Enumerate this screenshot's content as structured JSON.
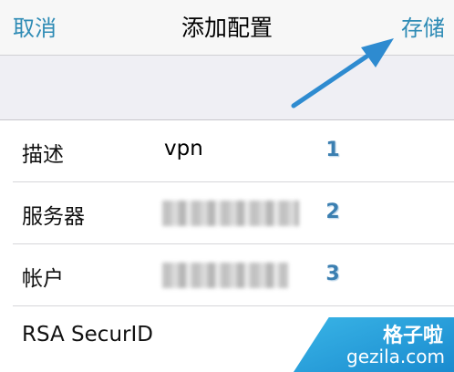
{
  "navbar": {
    "cancel_label": "取消",
    "title": "添加配置",
    "save_label": "存储"
  },
  "form": {
    "rows": [
      {
        "label": "描述",
        "value": "vpn",
        "step": "1"
      },
      {
        "label": "服务器",
        "value": "",
        "step": "2"
      },
      {
        "label": "帐户",
        "value": "",
        "step": "3"
      },
      {
        "label": "RSA SecurID",
        "value": ""
      }
    ]
  },
  "watermark": {
    "title": "格子啦",
    "url": "gezila.com"
  },
  "colors": {
    "accent": "#2e8bb5",
    "badge": "#3b7fb1",
    "background": "#efeff4",
    "watermark": "#1a8bcf"
  },
  "icons": {
    "annotation": "arrow-icon"
  }
}
